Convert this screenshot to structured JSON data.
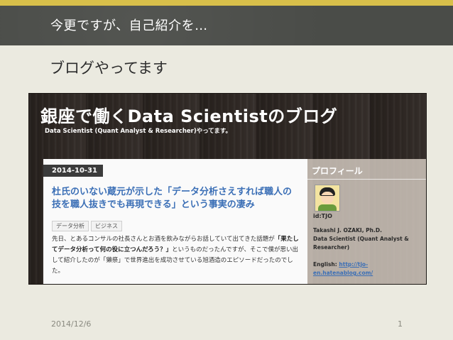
{
  "slide": {
    "title": "今更ですが、自己紹介を…",
    "subtitle": "ブログやってます",
    "footer_date": "2014/12/6",
    "page_number": "1",
    "accent_color": "#d8bf4a"
  },
  "blog": {
    "title": "銀座で働くData Scientistのブログ",
    "description": "Data Scientist (Quant Analyst & Researcher)やってます。",
    "post": {
      "date": "2014-10-31",
      "title": "杜氏のいない蔵元が示した「データ分析さえすれば職人の技を職人抜きでも再現できる」という事実の凄み",
      "tags": [
        "データ分析",
        "ビジネス"
      ],
      "body_pre": "先日、とあるコンサルの社長さんとお酒を飲みながらお話していて出てきた話題が",
      "body_bold": "「果たしてデータ分析って何の役に立つんだろう？」",
      "body_post": "というものだったんですが、そこで僕が思い出して紹介したのが「獺祭」で世界進出を成功させている旭酒造のエピソードだったのでした。"
    },
    "sidebar": {
      "heading": "プロフィール",
      "id": "id:TJO",
      "name": "Takashi J. OZAKI, Ph.D.",
      "role": "Data Scientist (Quant Analyst & Researcher)",
      "english_label": "English:",
      "english_link": "http://tjo-en.hatenablog.com/"
    }
  }
}
